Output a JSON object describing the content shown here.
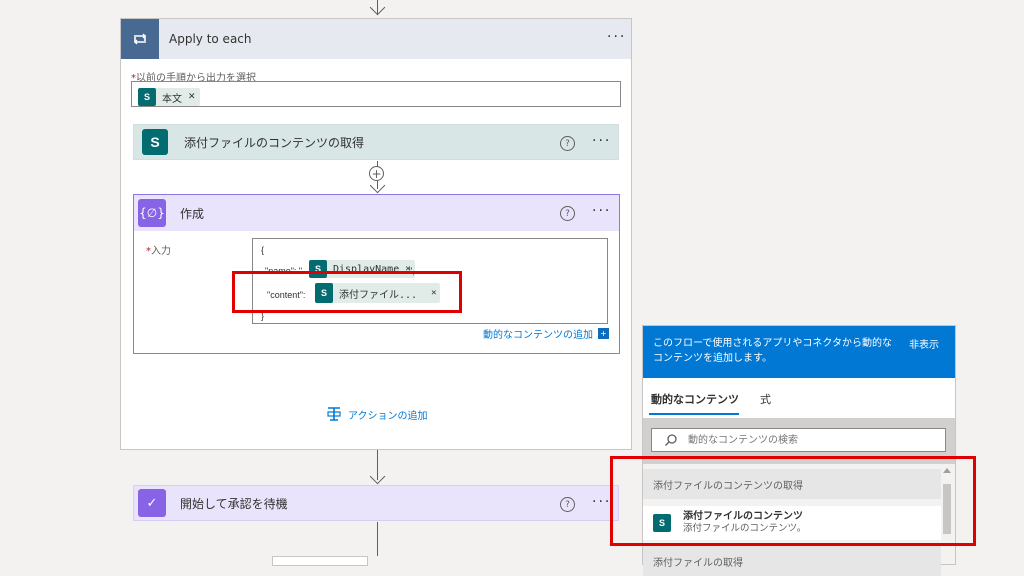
{
  "apply_to_each": {
    "title": "Apply to each",
    "select_label": "以前の手順から出力を選択",
    "select_token": "本文"
  },
  "sp_action": {
    "title": "添付ファイルのコンテンツの取得"
  },
  "compose": {
    "title": "作成",
    "input_label": "入力",
    "code": {
      "open_brace": "{",
      "name_key": "\"name\": \"",
      "name_token": "DisplayName",
      "name_tail": "\",",
      "content_key": "\"content\":",
      "content_token": "添付ファイル...",
      "close_brace": "}"
    },
    "add_dynamic": "動的なコンテンツの追加"
  },
  "add_action": "アクションの追加",
  "approval": {
    "title": "開始して承認を待機"
  },
  "panel": {
    "description": "このフローで使用されるアプリやコネクタから動的なコンテンツを追加します。",
    "hide": "非表示",
    "tabs": [
      "動的なコンテンツ",
      "式"
    ],
    "search_placeholder": "動的なコンテンツの検索",
    "section1": "添付ファイルのコンテンツの取得",
    "item_title": "添付ファイルのコンテンツ",
    "item_sub": "添付ファイルのコンテンツ。",
    "section2": "添付ファイルの取得"
  },
  "colors": {
    "accent": "#0078d4",
    "sharepoint": "#036c70",
    "compose": "#8764e5",
    "highlight": "#e00000"
  }
}
